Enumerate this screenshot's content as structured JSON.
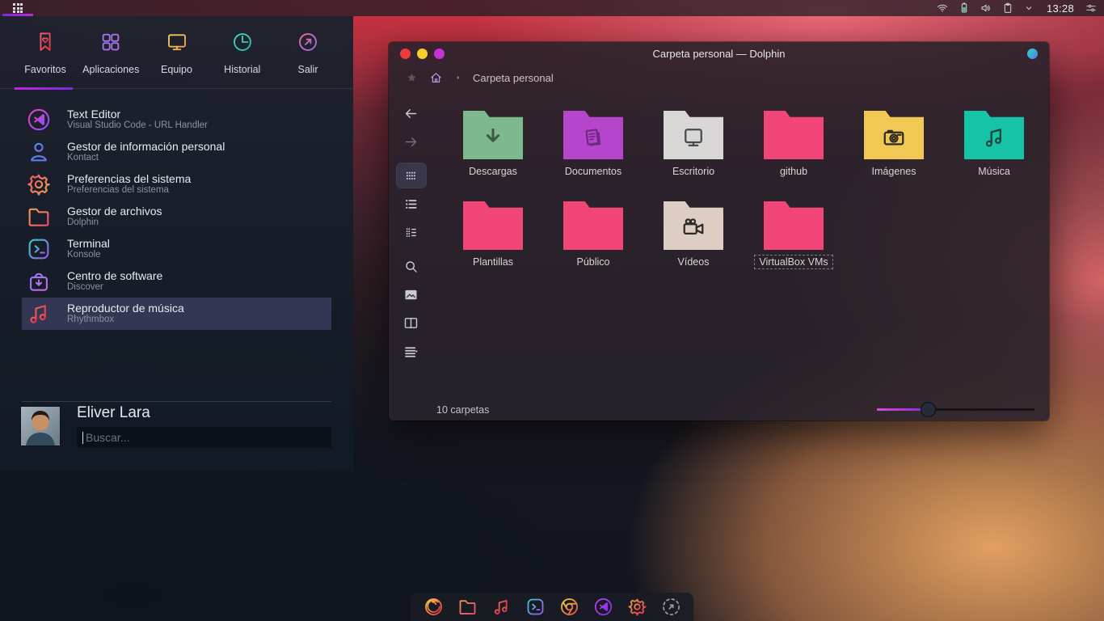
{
  "topbar": {
    "clock": "13:28",
    "tray_icons": [
      {
        "name": "network-wifi-icon"
      },
      {
        "name": "battery-icon"
      },
      {
        "name": "volume-icon"
      },
      {
        "name": "clipboard-icon"
      },
      {
        "name": "chevron-down-icon"
      },
      {
        "name": "clock-label"
      },
      {
        "name": "sliders-icon"
      }
    ]
  },
  "launcher": {
    "tabs": [
      {
        "label": "Favoritos",
        "icon": "bookmark-heart",
        "active": true,
        "c1": "#f65e7a",
        "c2": "#e8323e"
      },
      {
        "label": "Aplicaciones",
        "icon": "app-grid",
        "active": false,
        "c1": "#8a7cf0",
        "c2": "#c06ae0"
      },
      {
        "label": "Equipo",
        "icon": "monitor",
        "active": false,
        "c1": "#f3d15a",
        "c2": "#f0a050"
      },
      {
        "label": "Historial",
        "icon": "clock",
        "active": false,
        "c1": "#35e0c0",
        "c2": "#28b8a0"
      },
      {
        "label": "Salir",
        "icon": "exit-arrow",
        "active": false,
        "c1": "#f07090",
        "c2": "#9a6ae8"
      }
    ],
    "favorites": [
      {
        "title": "Text Editor",
        "subtitle": "Visual Studio Code - URL Handler",
        "icon": "vscode",
        "c1": "#e040c8",
        "c2": "#8a50f0",
        "highlighted": false
      },
      {
        "title": "Gestor de información personal",
        "subtitle": "Kontact",
        "icon": "person",
        "c1": "#4a90e8",
        "c2": "#7a6af0",
        "highlighted": false
      },
      {
        "title": "Preferencias del sistema",
        "subtitle": "Preferencias del sistema",
        "icon": "gear",
        "c1": "#f05a68",
        "c2": "#f0a050",
        "highlighted": false
      },
      {
        "title": "Gestor de archivos",
        "subtitle": "Dolphin",
        "icon": "folder",
        "c1": "#f0a050",
        "c2": "#f04878",
        "highlighted": false
      },
      {
        "title": "Terminal",
        "subtitle": "Konsole",
        "icon": "terminal",
        "c1": "#38d0c8",
        "c2": "#9a5af0",
        "highlighted": false
      },
      {
        "title": "Centro de software",
        "subtitle": "Discover",
        "icon": "bag-download",
        "c1": "#9a7af0",
        "c2": "#c06ae0",
        "highlighted": false
      },
      {
        "title": "Reproductor de música",
        "subtitle": "Rhythmbox",
        "icon": "music-note",
        "c1": "#f0684a",
        "c2": "#e82860",
        "highlighted": true
      }
    ],
    "user": {
      "name": "Eliver Lara",
      "search_placeholder": "Buscar..."
    }
  },
  "dolphin": {
    "title": "Carpeta personal — Dolphin",
    "breadcrumb_location": "Carpeta personal",
    "window_control_colors": [
      "#ef3b3b",
      "#f5cf2c",
      "#c633d8"
    ],
    "toolbar": [
      {
        "name": "back",
        "state": "normal"
      },
      {
        "name": "forward",
        "state": "dim"
      },
      {
        "name": "view-grid",
        "state": "active"
      },
      {
        "name": "view-list",
        "state": "normal"
      },
      {
        "name": "view-compact",
        "state": "normal"
      },
      {
        "name": "search",
        "state": "normal"
      },
      {
        "name": "preview",
        "state": "normal"
      },
      {
        "name": "split",
        "state": "normal"
      },
      {
        "name": "menu",
        "state": "normal"
      }
    ],
    "folders": [
      {
        "name": "Descargas",
        "color": "#7eb98d",
        "glyph": "download",
        "glyph_color": "#3c5948",
        "selected": false
      },
      {
        "name": "Documentos",
        "color": "#b545cb",
        "glyph": "documents",
        "glyph_color": "#6e2a80",
        "selected": false
      },
      {
        "name": "Escritorio",
        "color": "#d9d6d6",
        "glyph": "monitor",
        "glyph_color": "#4a4a4e",
        "selected": false
      },
      {
        "name": "github",
        "color": "#f24679",
        "glyph": "none",
        "glyph_color": "",
        "selected": false
      },
      {
        "name": "Imágenes",
        "color": "#f2c854",
        "glyph": "camera",
        "glyph_color": "#2e2a20",
        "selected": false
      },
      {
        "name": "Música",
        "color": "#17c3a6",
        "glyph": "music",
        "glyph_color": "#23443e",
        "selected": false
      },
      {
        "name": "Plantillas",
        "color": "#f24679",
        "glyph": "none",
        "glyph_color": "",
        "selected": false
      },
      {
        "name": "Público",
        "color": "#f24679",
        "glyph": "none",
        "glyph_color": "",
        "selected": false
      },
      {
        "name": "Vídeos",
        "color": "#ddcdc2",
        "glyph": "video",
        "glyph_color": "#2e2a28",
        "selected": false
      },
      {
        "name": "VirtualBox VMs",
        "color": "#f24679",
        "glyph": "none",
        "glyph_color": "",
        "selected": true
      }
    ],
    "status_text": "10 carpetas",
    "zoom_slider_percent": 30
  },
  "dock": {
    "items": [
      {
        "name": "firefox",
        "c1": "#f5c94a",
        "c2": "#e8303e"
      },
      {
        "name": "file-manager",
        "c1": "#f0955a",
        "c2": "#f04878"
      },
      {
        "name": "rhythmbox",
        "c1": "#f0684a",
        "c2": "#e82860"
      },
      {
        "name": "konsole",
        "c1": "#38d0c8",
        "c2": "#9a5af0"
      },
      {
        "name": "chromium",
        "c1": "#f0d04a",
        "c2": "#e84848"
      },
      {
        "name": "vscode",
        "c1": "#c040e8",
        "c2": "#7a30e8"
      },
      {
        "name": "settings",
        "c1": "#f0a040",
        "c2": "#e83050"
      },
      {
        "name": "dock-edit",
        "c1": "#9aa0ac",
        "c2": "#8a909c"
      }
    ]
  }
}
